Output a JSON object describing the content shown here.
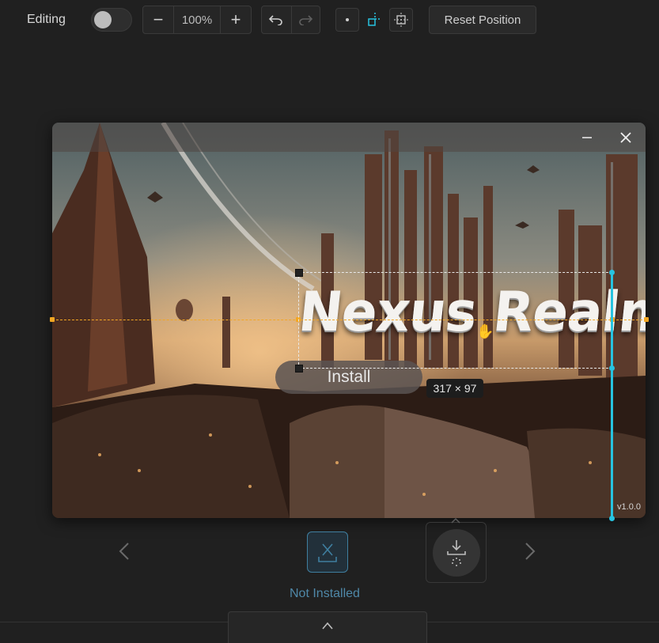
{
  "toolbar": {
    "editing_label": "Editing",
    "zoom_value": "100%",
    "zoom_out": "−",
    "zoom_in": "+",
    "reset_label": "Reset Position"
  },
  "preview": {
    "version": "v1.0.0",
    "install_label": "Install",
    "logo_text": "Nexus Realms",
    "dimensions": "317 × 97"
  },
  "carousel": {
    "status": "Not Installed"
  },
  "colors": {
    "guide_horizontal": "#f2a623",
    "guide_vertical": "#27c3e0",
    "status": "#4f88a8"
  }
}
